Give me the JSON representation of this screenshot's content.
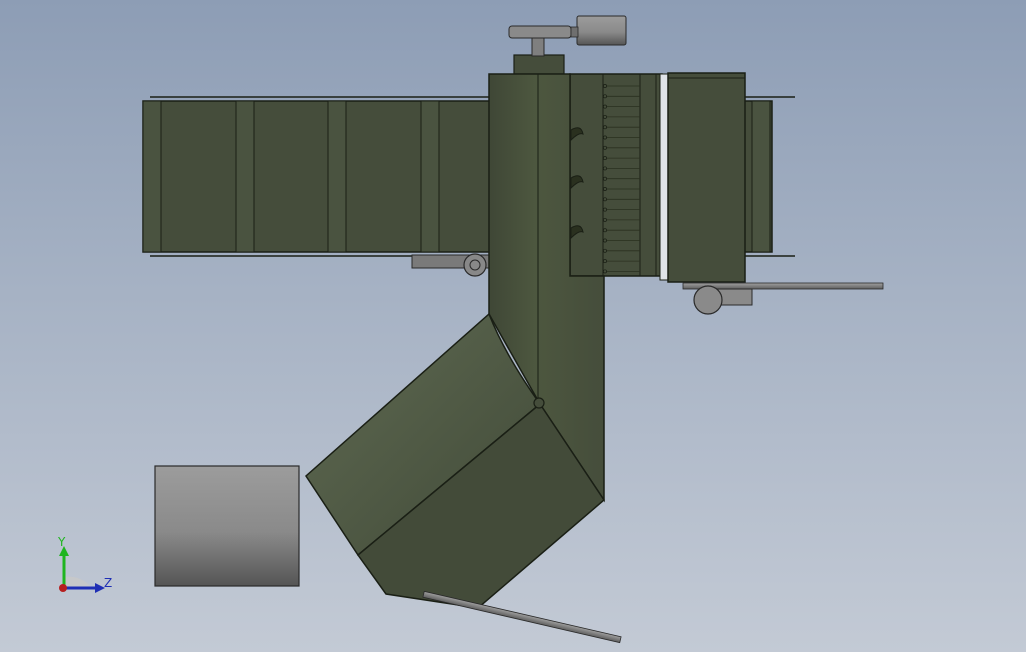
{
  "viewport": {
    "background_top": "#8d9db5",
    "background_bottom": "#c3cad5"
  },
  "model": {
    "body_color": "#454d3b",
    "body_light": "#55604a",
    "edge_color": "#1a1f15",
    "gray_part_color": "#8a8a8a"
  },
  "triad": {
    "y_label": "Y",
    "z_label": "Z",
    "y_color": "#1fb51f",
    "z_color": "#1f2fb5",
    "x_color": "#b51f1f"
  }
}
